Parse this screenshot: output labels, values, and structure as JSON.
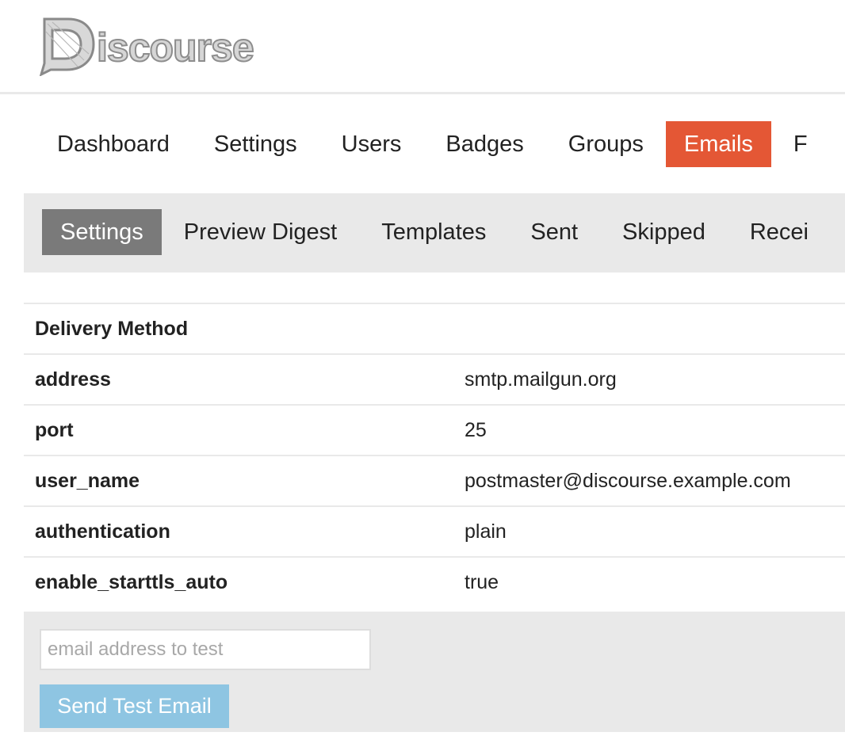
{
  "header": {
    "logo_text": "iscourse",
    "logo_icon": "discourse-speech-bubble-logo"
  },
  "main_nav": {
    "items": [
      {
        "label": "Dashboard"
      },
      {
        "label": "Settings"
      },
      {
        "label": "Users"
      },
      {
        "label": "Badges"
      },
      {
        "label": "Groups"
      },
      {
        "label": "Emails"
      },
      {
        "label": "F"
      }
    ],
    "active": "Emails"
  },
  "sub_nav": {
    "items": [
      {
        "label": "Settings"
      },
      {
        "label": "Preview Digest"
      },
      {
        "label": "Templates"
      },
      {
        "label": "Sent"
      },
      {
        "label": "Skipped"
      },
      {
        "label": "Recei"
      }
    ],
    "active": "Settings"
  },
  "settings": {
    "section_title": "Delivery Method",
    "rows": [
      {
        "key": "address",
        "value": "smtp.mailgun.org"
      },
      {
        "key": "port",
        "value": "25"
      },
      {
        "key": "user_name",
        "value": "postmaster@discourse.example.com"
      },
      {
        "key": "authentication",
        "value": "plain"
      },
      {
        "key": "enable_starttls_auto",
        "value": "true"
      }
    ]
  },
  "test_email": {
    "placeholder": "email address to test",
    "value": "",
    "button_label": "Send Test Email"
  },
  "colors": {
    "accent": "#e45735",
    "sub_active": "#7a7a7a",
    "button": "#8ec5e2",
    "panel": "#e9e9e9"
  }
}
